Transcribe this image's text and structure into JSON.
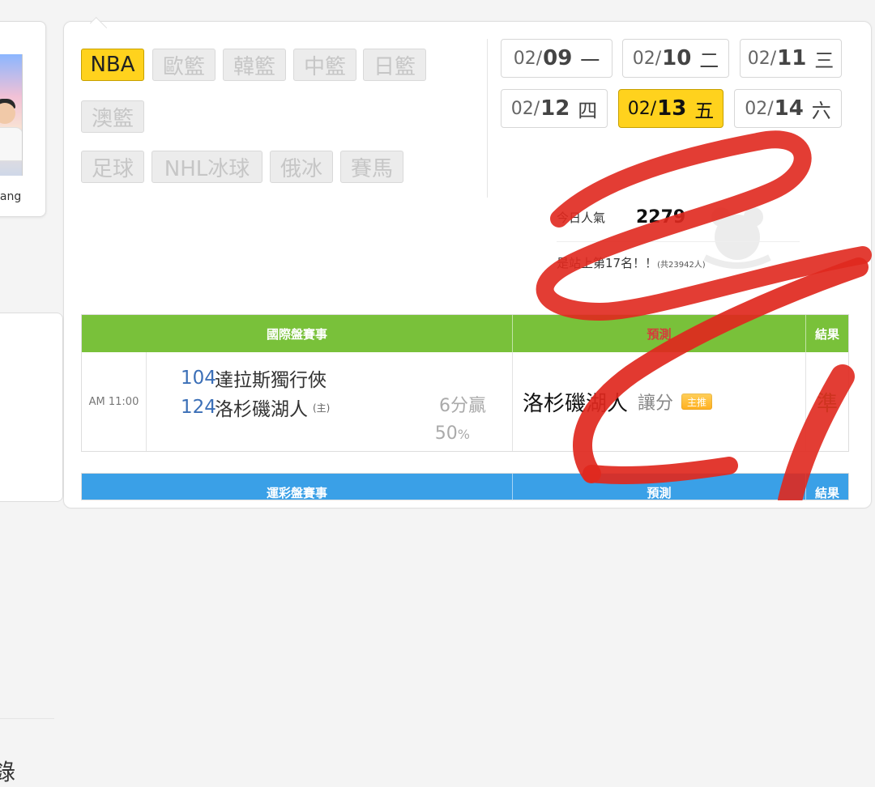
{
  "left": {
    "name_partial": "uang",
    "text_partial": "錄"
  },
  "sports_tabs": [
    {
      "label": "NBA",
      "active": true
    },
    {
      "label": "歐籃",
      "active": false
    },
    {
      "label": "韓籃",
      "active": false
    },
    {
      "label": "中籃",
      "active": false
    },
    {
      "label": "日籃",
      "active": false
    },
    {
      "label": "澳籃",
      "active": false
    },
    {
      "label": "足球",
      "active": false
    },
    {
      "label": "NHL冰球",
      "active": false
    },
    {
      "label": "俄冰",
      "active": false
    },
    {
      "label": "賽馬",
      "active": false
    }
  ],
  "dates": [
    {
      "md": "02/",
      "d": "09",
      "w": "一",
      "active": false
    },
    {
      "md": "02/",
      "d": "10",
      "w": "二",
      "active": false
    },
    {
      "md": "02/",
      "d": "11",
      "w": "三",
      "active": false
    },
    {
      "md": "02/",
      "d": "12",
      "w": "四",
      "active": false
    },
    {
      "md": "02/",
      "d": "13",
      "w": "五",
      "active": true
    },
    {
      "md": "02/",
      "d": "14",
      "w": "六",
      "active": false
    }
  ],
  "popularity": {
    "label": "今日人氣",
    "count": "2279",
    "rank_text": "是站上第17名！！",
    "rank_total": "(共23942人)"
  },
  "table1": {
    "header": {
      "col1": "國際盤賽事",
      "col2": "預測",
      "col3": "結果"
    },
    "row": {
      "time": "AM 11:00",
      "away_score": "104",
      "away_team": "達拉斯獨行俠",
      "home_score": "124",
      "home_team": "洛杉磯湖人",
      "home_marker": "(主)",
      "spread": "6分贏",
      "pct": "50",
      "pct_unit": "%",
      "pred_team": "洛杉磯湖人",
      "pred_type": "讓分",
      "badge": "主推",
      "result": "準"
    }
  },
  "table2": {
    "header": {
      "col1": "運彩盤賽事",
      "col2": "預測",
      "col3": "結果"
    }
  },
  "colors": {
    "active_yellow": "#ffd21d",
    "header_green": "#79c13a",
    "header_blue": "#3aa0e7",
    "result_green": "#2d9c2f",
    "score_blue": "#3b6fb7",
    "scribble_red": "#e0281e"
  }
}
